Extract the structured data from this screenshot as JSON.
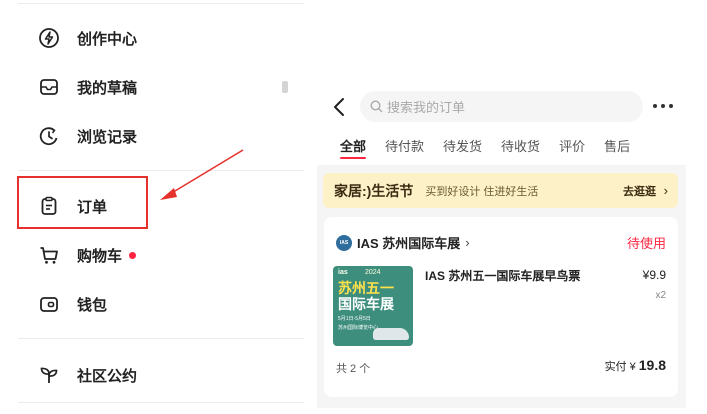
{
  "menu": {
    "items": [
      {
        "label": "创作中心",
        "icon": "lightning-icon"
      },
      {
        "label": "我的草稿",
        "icon": "inbox-icon"
      },
      {
        "label": "浏览记录",
        "icon": "clock-icon"
      },
      {
        "label": "订单",
        "icon": "clipboard-icon"
      },
      {
        "label": "购物车",
        "icon": "cart-icon"
      },
      {
        "label": "钱包",
        "icon": "wallet-icon"
      },
      {
        "label": "社区公约",
        "icon": "sprout-icon"
      }
    ]
  },
  "colors": {
    "accent": "#ff2442",
    "highlight": "#e5322d",
    "banner_bg": "#fdf1c8"
  },
  "orders": {
    "search_placeholder": "搜索我的订单",
    "tabs": [
      "全部",
      "待付款",
      "待发货",
      "待收货",
      "评价",
      "售后"
    ],
    "active_tab": "全部",
    "banner": {
      "title": "家居:)生活节",
      "subtitle": "买到好设计 住进好生活",
      "link": "去逛逛"
    },
    "card": {
      "shop_name": "IAS 苏州国际车展",
      "status": "待使用",
      "product_title": "IAS 苏州五一国际车展早鸟票",
      "price": "¥9.9",
      "quantity": "x2",
      "count": "共 2 个",
      "paid_label": "实付 ¥",
      "paid_value": "19.8",
      "thumb": {
        "brand": "ias",
        "year": "2024",
        "line1": "苏州五一",
        "line2": "国际车展",
        "date": "5月1日-5月5日",
        "venue": "苏州国际博览中心"
      }
    }
  }
}
